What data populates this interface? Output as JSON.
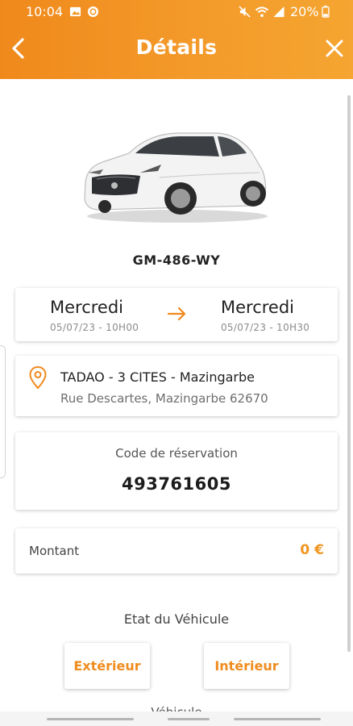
{
  "status_bar": {
    "time": "10:04",
    "battery": "20%"
  },
  "header": {
    "title": "Détails"
  },
  "vehicle": {
    "plate": "GM-486-WY"
  },
  "booking": {
    "start": {
      "day": "Mercredi",
      "datetime": "05/07/23 - 10H00"
    },
    "end": {
      "day": "Mercredi",
      "datetime": "05/07/23 - 10H30"
    }
  },
  "location": {
    "name": "TADAO - 3 CITES - Mazingarbe",
    "address": "Rue Descartes, Mazingarbe 62670"
  },
  "reservation": {
    "label": "Code de réservation",
    "code": "493761605"
  },
  "amount": {
    "label": "Montant",
    "value": "0 €"
  },
  "vehicle_state": {
    "title": "Etat du Véhicule",
    "exterior_button": "Extérieur",
    "interior_button": "Intérieur",
    "next_section_cut": "Véhicule"
  },
  "colors": {
    "accent": "#f0891c",
    "header_end": "#f5a531",
    "amount": "#f0951f"
  },
  "icons": [
    "back-arrow-icon",
    "close-icon",
    "arrow-right-icon",
    "location-pin-icon",
    "image-icon",
    "whatsapp-icon",
    "mute-icon",
    "wifi-icon",
    "signal-icon",
    "battery-icon"
  ]
}
